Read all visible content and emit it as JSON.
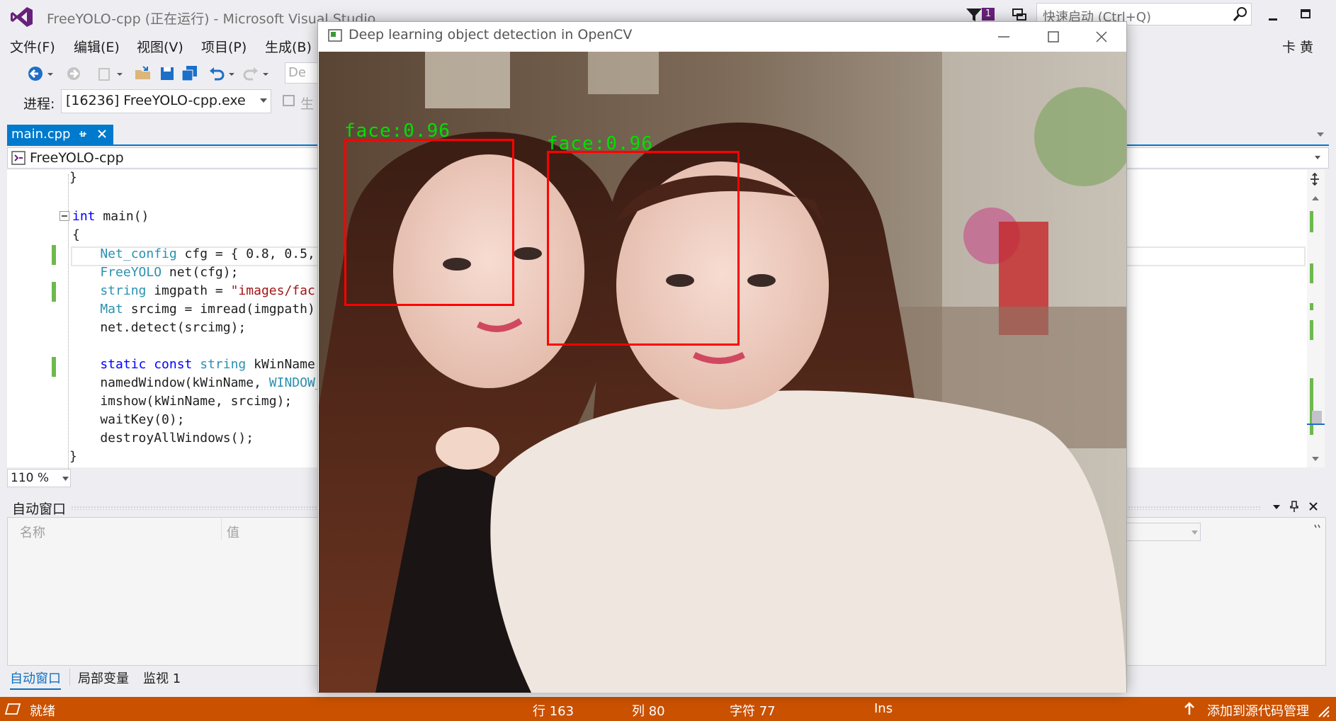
{
  "app": {
    "title": "FreeYOLO-cpp (正在运行) - Microsoft Visual Studio",
    "notification_count": "1",
    "quick_launch_placeholder": "快速启动 (Ctrl+Q)",
    "user": "卡 黄"
  },
  "menu": [
    "文件(F)",
    "编辑(E)",
    "视图(V)",
    "项目(P)",
    "生成(B)"
  ],
  "toolbar": {
    "process_label": "进程:",
    "process_value": "[16236] FreeYOLO-cpp.exe",
    "partial_items": [
      "De",
      "生"
    ]
  },
  "editor": {
    "tab_label": "main.cpp",
    "project_dropdown": "FreeYOLO-cpp",
    "zoom": "110 %",
    "lines": [
      "}",
      "",
      "int main()",
      "{",
      "    Net_config cfg = { 0.8, 0.5,",
      "    FreeYOLO net(cfg);",
      "    string imgpath = \"images/fac",
      "    Mat srcimg = imread(imgpath)",
      "    net.detect(srcimg);",
      "",
      "    static const string kWinName",
      "    namedWindow(kWinName, WINDOW_",
      "    imshow(kWinName, srcimg);",
      "    waitKey(0);",
      "    destroyAllWindows();",
      "}"
    ]
  },
  "autos": {
    "title": "自动窗口",
    "col_name": "名称",
    "col_value": "值",
    "tabs": [
      "自动窗口",
      "局部变量",
      "监视 1"
    ]
  },
  "status": {
    "ready": "就绪",
    "line": "行 163",
    "col": "列 80",
    "char": "字符 77",
    "ins": "Ins",
    "source_control": "添加到源代码管理",
    "color": "#ca5100"
  },
  "cv_window": {
    "title": "Deep learning object detection in OpenCV",
    "detections": [
      {
        "label": "face:0.96"
      },
      {
        "label": "face:0.96"
      }
    ],
    "box_color": "#ff0000",
    "label_color": "#00e000"
  }
}
